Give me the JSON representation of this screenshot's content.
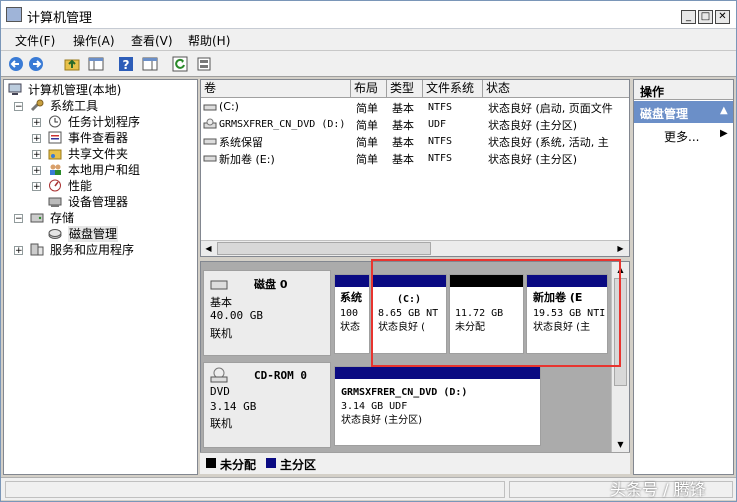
{
  "window": {
    "title": "计算机管理"
  },
  "menu": [
    "文件(F)",
    "操作(A)",
    "查看(V)",
    "帮助(H)"
  ],
  "tree": {
    "root": "计算机管理(本地)",
    "system_tools": "系统工具",
    "task_scheduler": "任务计划程序",
    "event_viewer": "事件查看器",
    "shared_folders": "共享文件夹",
    "local_users": "本地用户和组",
    "performance": "性能",
    "device_manager": "设备管理器",
    "storage": "存储",
    "disk_management": "磁盘管理",
    "services": "服务和应用程序"
  },
  "volumes": {
    "headers": [
      "卷",
      "布局",
      "类型",
      "文件系统",
      "状态"
    ],
    "rows": [
      {
        "name": "(C:)",
        "layout": "简单",
        "type": "基本",
        "fs": "NTFS",
        "status": "状态良好 (启动, 页面文件"
      },
      {
        "name": "GRMSXFRER_CN_DVD (D:)",
        "layout": "简单",
        "type": "基本",
        "fs": "UDF",
        "status": "状态良好 (主分区)"
      },
      {
        "name": "系统保留",
        "layout": "简单",
        "type": "基本",
        "fs": "NTFS",
        "status": "状态良好 (系统, 活动, 主"
      },
      {
        "name": "新加卷 (E:)",
        "layout": "简单",
        "type": "基本",
        "fs": "NTFS",
        "status": "状态良好 (主分区)"
      }
    ]
  },
  "disks": {
    "disk0": {
      "name": "磁盘 0",
      "type": "基本",
      "size": "40.00 GB",
      "state": "联机",
      "partitions": [
        {
          "name": "系统",
          "size": "100",
          "status": "状态"
        },
        {
          "name": "(C:)",
          "size": "8.65 GB NT",
          "status": "状态良好 ("
        },
        {
          "name": "",
          "size": "11.72 GB",
          "status": "未分配"
        },
        {
          "name": "新加卷 (E",
          "size": "19.53 GB NTI",
          "status": "状态良好 (主"
        }
      ]
    },
    "cdrom0": {
      "name": "CD-ROM 0",
      "type": "DVD",
      "size": "3.14 GB",
      "state": "联机",
      "partition": {
        "name": "GRMSXFRER_CN_DVD  (D:)",
        "size": "3.14 GB UDF",
        "status": "状态良好 (主分区)"
      }
    }
  },
  "legend": {
    "unallocated": "未分配",
    "primary": "主分区"
  },
  "actions": {
    "title": "操作",
    "section": "磁盘管理",
    "more": "更多..."
  },
  "watermark": "头条号 / 腾锋",
  "colors": {
    "primary_bar": "#0a0a82",
    "unallocated_bar": "#000000",
    "highlight": "#e8342f",
    "action_header": "#6b8fc8"
  }
}
